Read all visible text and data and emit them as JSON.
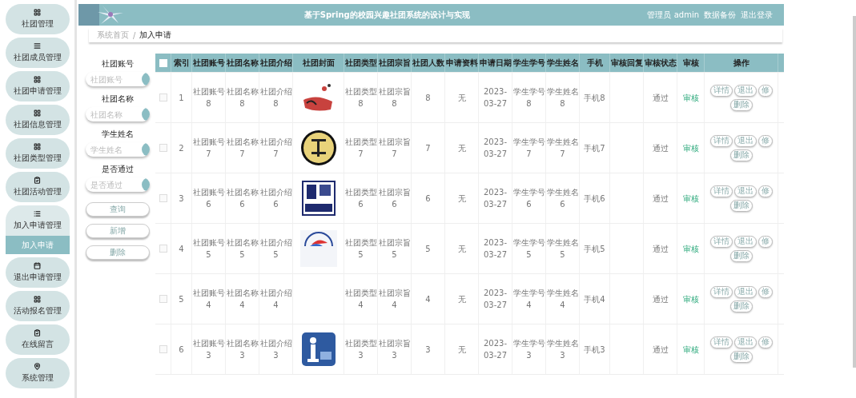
{
  "sidebar": {
    "items": [
      {
        "label": "社团管理",
        "expanded": false
      },
      {
        "label": "社团成员管理",
        "expanded": false
      },
      {
        "label": "社团申请管理",
        "expanded": false
      },
      {
        "label": "社团信息管理",
        "expanded": false
      },
      {
        "label": "社团类型管理",
        "expanded": false
      },
      {
        "label": "社团活动管理",
        "expanded": false
      },
      {
        "label": "加入申请管理",
        "expanded": true,
        "children": [
          {
            "label": "加入申请",
            "selected": true
          }
        ]
      },
      {
        "label": "退出申请管理",
        "expanded": false
      },
      {
        "label": "活动报名管理",
        "expanded": false
      },
      {
        "label": "在线留言",
        "expanded": false
      },
      {
        "label": "系统管理",
        "expanded": false
      }
    ]
  },
  "header": {
    "title": "基于Spring的校园兴趣社团系统的设计与实现",
    "user": "管理员 admin",
    "links": [
      "数据备份",
      "退出登录"
    ]
  },
  "breadcrumb": [
    "系统首页",
    "/",
    "加入申请"
  ],
  "search": {
    "fields": [
      {
        "label": "社团账号",
        "placeholder": "社团账号"
      },
      {
        "label": "社团名称",
        "placeholder": "社团名称"
      },
      {
        "label": "学生姓名",
        "placeholder": "学生姓名"
      },
      {
        "label": "是否通过",
        "placeholder": "是否通过"
      }
    ],
    "buttons": [
      "查询",
      "新增",
      "删除"
    ]
  },
  "table": {
    "header_checked": false,
    "columns": [
      "索引",
      "社团账号",
      "社团名称",
      "社团介绍",
      "社团封面",
      "社团类型",
      "社团宗旨",
      "社团人数",
      "申请资料",
      "申请日期",
      "学生学号",
      "学生姓名",
      "手机",
      "审核回复",
      "审核状态",
      "审核",
      "操作"
    ],
    "rows": [
      {
        "checked": false,
        "cells": [
          "1",
          "社团账号 8",
          "社团名称 8",
          "社团介绍 8",
          {
            "kind": "picture"
          },
          "社团类型 8",
          "社团宗旨 8",
          "8",
          "无",
          "2023-03-27",
          "学生学号 8",
          "学生姓名 8",
          "手机8",
          "",
          "通过",
          "审核"
        ],
        "actions": [
          "详情",
          "退出",
          "修",
          "删除"
        ]
      },
      {
        "checked": false,
        "cells": [
          "2",
          "社团账号 7",
          "社团名称 7",
          "社团介绍 7",
          {
            "kind": "picture"
          },
          "社团类型 7",
          "社团宗旨 7",
          "7",
          "无",
          "2023-03-27",
          "学生学号 7",
          "学生姓名 7",
          "手机7",
          "",
          "通过",
          "审核"
        ],
        "actions": [
          "详情",
          "退出",
          "修",
          "删除"
        ]
      },
      {
        "checked": false,
        "cells": [
          "3",
          "社团账号 6",
          "社团名称 6",
          "社团介绍 6",
          {
            "kind": "picture"
          },
          "社团类型 6",
          "社团宗旨 6",
          "6",
          "无",
          "2023-03-27",
          "学生学号 6",
          "学生姓名 6",
          "手机6",
          "",
          "通过",
          "审核"
        ],
        "actions": [
          "详情",
          "退出",
          "修",
          "删除"
        ]
      },
      {
        "checked": false,
        "cells": [
          "4",
          "社团账号 5",
          "社团名称 5",
          "社团介绍 5",
          {
            "kind": "picture"
          },
          "社团类型 5",
          "社团宗旨 5",
          "5",
          "无",
          "2023-03-27",
          "学生学号 5",
          "学生姓名 5",
          "手机5",
          "",
          "通过",
          "审核"
        ],
        "actions": [
          "详情",
          "退出",
          "修",
          "删除"
        ]
      },
      {
        "checked": false,
        "cells": [
          "5",
          "社团账号 4",
          "社团名称 4",
          "社团介绍 4",
          {
            "kind": "empty"
          },
          "社团类型 4",
          "社团宗旨 4",
          "4",
          "无",
          "2023-03-27",
          "学生学号 4",
          "学生姓名 4",
          "手机4",
          "",
          "通过",
          "审核"
        ],
        "actions": [
          "详情",
          "退出",
          "修",
          "删除"
        ]
      },
      {
        "checked": false,
        "cells": [
          "6",
          "社团账号 3",
          "社团名称 3",
          "社团介绍 3",
          {
            "kind": "picture"
          },
          "社团类型 3",
          "社团宗旨 3",
          "3",
          "无",
          "2023-03-27",
          "学生学号 3",
          "学生姓名 3",
          "手机3",
          "",
          "通过",
          "审核"
        ],
        "actions": [
          "详情",
          "退出",
          "修",
          "删除"
        ]
      }
    ]
  }
}
